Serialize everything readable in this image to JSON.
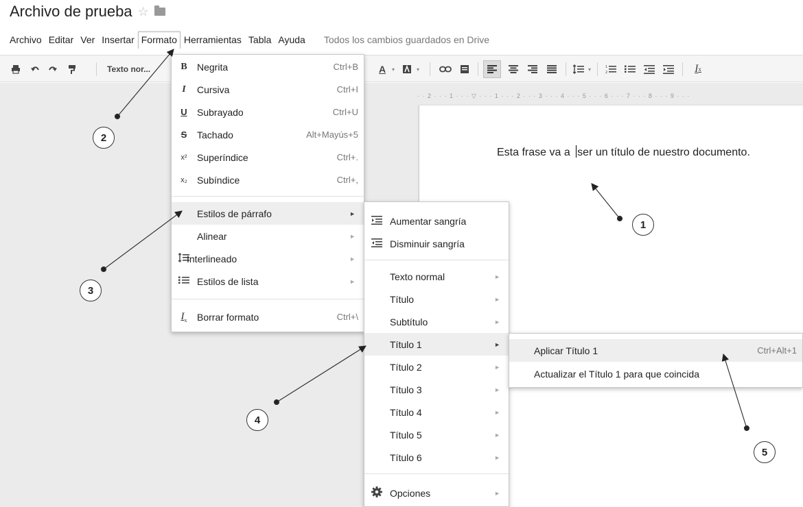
{
  "header": {
    "title": "Archivo de prueba",
    "star": "☆",
    "menus": [
      "Archivo",
      "Editar",
      "Ver",
      "Insertar",
      "Formato",
      "Herramientas",
      "Tabla",
      "Ayuda"
    ],
    "saved_status": "Todos los cambios guardados en Drive"
  },
  "toolbar": {
    "style_select": "Texto nor..."
  },
  "ruler": {
    "text": "· · 2 · · · 1 · · · ▽ · · · 1 · · · 2 · · · 3 · · · 4 · · · 5 · · · 6 · · · 7 · · · 8 · · · 9 · · ·"
  },
  "document": {
    "text_before": "Esta frase va  a ",
    "text_after": "ser un título de nuestro documento."
  },
  "format_menu": {
    "items": [
      {
        "icon": "B",
        "label": "Negrita",
        "shortcut": "Ctrl+B"
      },
      {
        "icon": "I",
        "label": "Cursiva",
        "shortcut": "Ctrl+I"
      },
      {
        "icon": "U",
        "label": "Subrayado",
        "shortcut": "Ctrl+U"
      },
      {
        "icon": "S",
        "label": "Tachado",
        "shortcut": "Alt+Mayús+5"
      },
      {
        "icon": "x²",
        "label": "Superíndice",
        "shortcut": "Ctrl+."
      },
      {
        "icon": "x₂",
        "label": "Subíndice",
        "shortcut": "Ctrl+,"
      },
      {
        "label": "Estilos de párrafo"
      },
      {
        "label": "Alinear"
      },
      {
        "label": "Interlineado"
      },
      {
        "label": "Estilos de lista"
      },
      {
        "label": "Borrar formato",
        "shortcut": "Ctrl+\\"
      }
    ]
  },
  "paragraph_menu": {
    "items": [
      {
        "label": "Aumentar sangría"
      },
      {
        "label": "Disminuir sangría"
      },
      {
        "label": "Texto normal"
      },
      {
        "label": "Título"
      },
      {
        "label": "Subtítulo"
      },
      {
        "label": "Título 1"
      },
      {
        "label": "Título 2"
      },
      {
        "label": "Título 3"
      },
      {
        "label": "Título 4"
      },
      {
        "label": "Título 5"
      },
      {
        "label": "Título 6"
      },
      {
        "label": "Opciones"
      }
    ]
  },
  "heading_menu": {
    "items": [
      {
        "label": "Aplicar Título 1",
        "shortcut": "Ctrl+Alt+1"
      },
      {
        "label": "Actualizar el Título 1 para que coincida"
      }
    ]
  },
  "callouts": [
    "1",
    "2",
    "3",
    "4",
    "5"
  ]
}
